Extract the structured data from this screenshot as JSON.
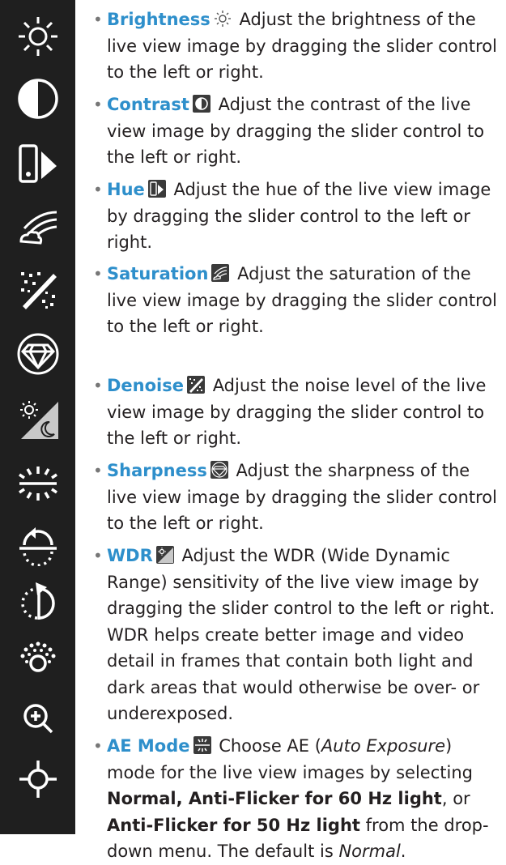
{
  "sidebar": {
    "icons": [
      "brightness-icon",
      "contrast-icon",
      "hue-icon",
      "saturation-icon",
      "denoise-icon",
      "sharpness-icon",
      "wdr-icon",
      "ae-mode-icon",
      "rotate-left-icon",
      "rotate-right-icon",
      "light-icon",
      "zoom-icon",
      "focus-icon"
    ]
  },
  "items": [
    {
      "term": "Brightness",
      "desc": "Adjust the brightness of the live view image by dragging the slider control to the left or right."
    },
    {
      "term": "Contrast",
      "desc": "Adjust the contrast of the live view image by dragging the slider control to the left or right."
    },
    {
      "term": "Hue",
      "desc": "Adjust the hue of the live view image by dragging the slider control to the left or right."
    },
    {
      "term": "Saturation",
      "desc": "Adjust the saturation of the live view image by dragging the slider control to the left or right."
    },
    {
      "term": "Denoise",
      "desc": "Adjust the noise level of the live view image by dragging the slider control to the left or right."
    },
    {
      "term": "Sharpness",
      "desc": "Adjust the sharpness of the live view image by dragging the slider control to the left or right."
    },
    {
      "term": "WDR",
      "desc": "Adjust the WDR (Wide Dynamic Range) sensitivity of the live view image by dragging the slider control to the left or right. WDR helps create better image and video detail in frames that contain both light and dark areas that would otherwise be over- or underexposed."
    },
    {
      "term": "AE Mode",
      "p1": "Choose AE (",
      "p1_italic": "Auto Exposure",
      "p2": ") mode for the live view images by selecting ",
      "b1": "Normal, Anti-Flicker for 60 Hz light",
      "p3": ", or ",
      "b2": "Anti-Flicker for 50 Hz light",
      "p4": " from the drop-down menu. The default is ",
      "p4_italic": "Normal",
      "p5": "."
    }
  ]
}
